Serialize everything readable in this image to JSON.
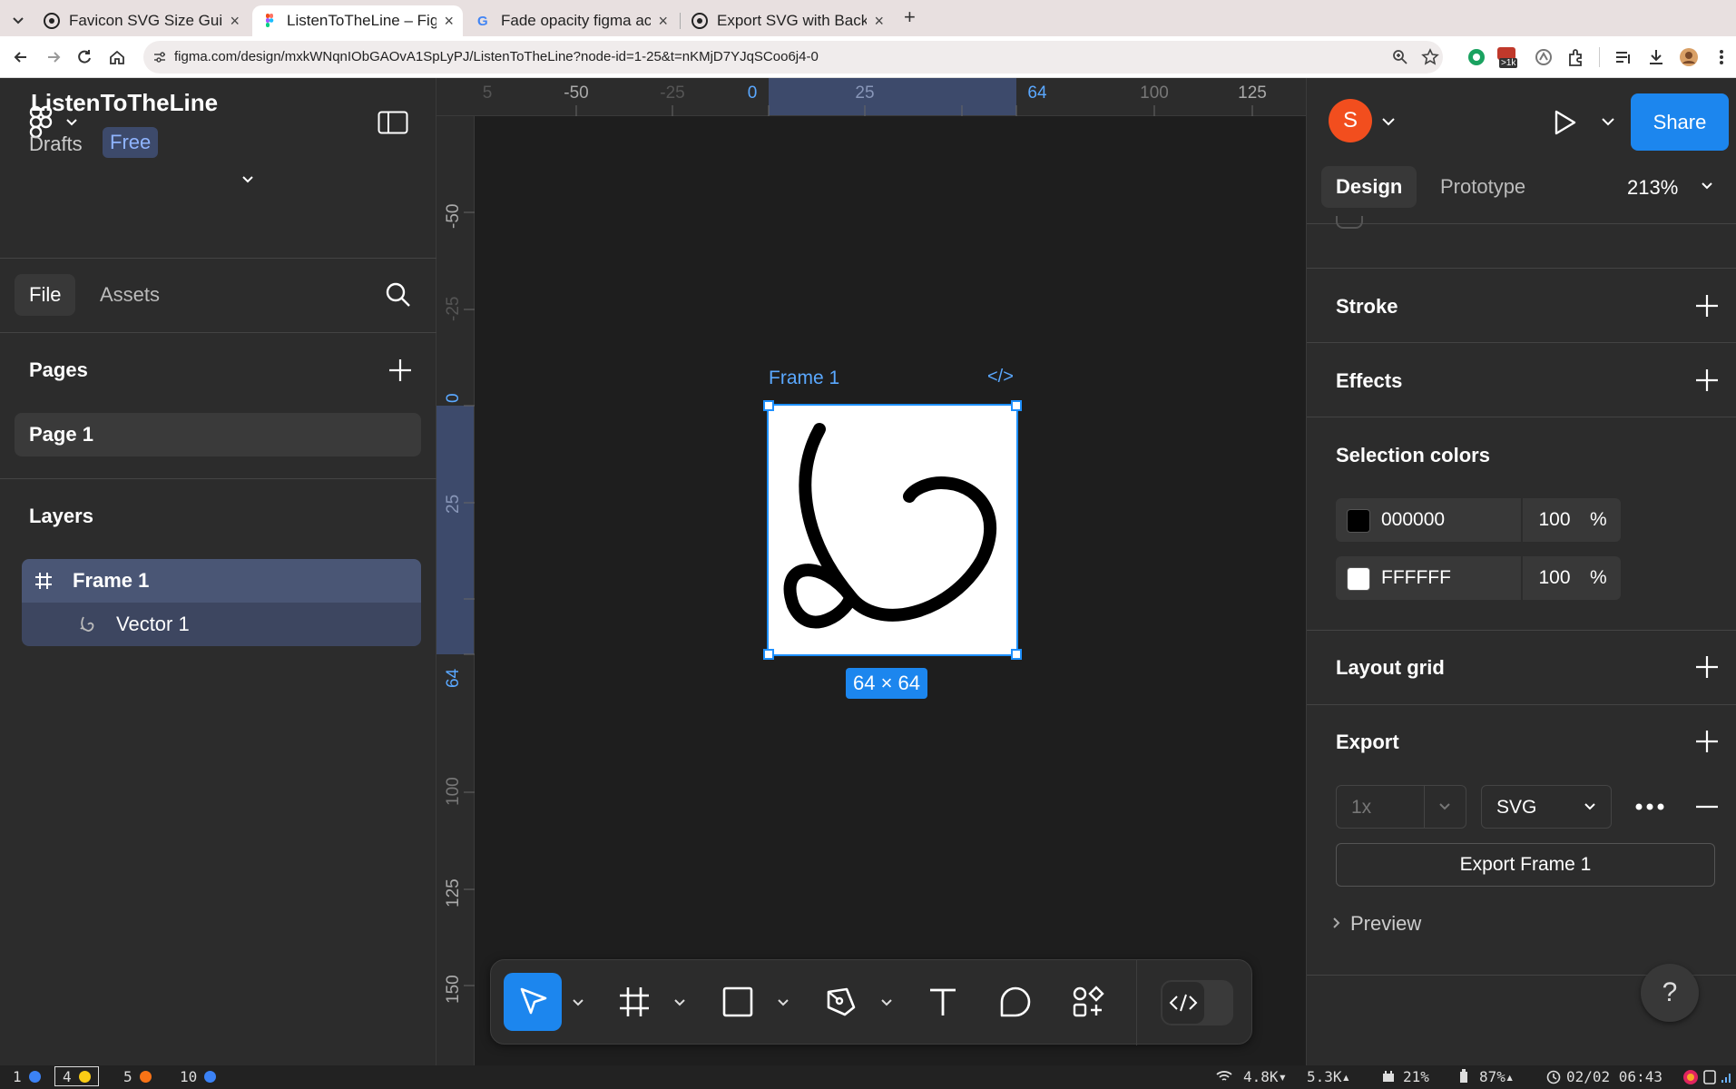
{
  "browser": {
    "tabs": [
      {
        "title": "Favicon SVG Size Guid"
      },
      {
        "title": "ListenToTheLine – Figm"
      },
      {
        "title": "Fade opacity figma ac"
      },
      {
        "title": "Export SVG with Back"
      }
    ],
    "new_tab": "+",
    "url": "figma.com/design/mxkWNqnIObGAOvA1SpLyPJ/ListenToTheLine?node-id=1-25&t=nKMjD7YJqSCoo6j4-0",
    "ext_badge": ">1k"
  },
  "left_panel": {
    "file_name": "ListenToTheLine",
    "drafts": "Drafts",
    "plan_badge": "Free",
    "tabs": {
      "file": "File",
      "assets": "Assets"
    },
    "pages_heading": "Pages",
    "pages": [
      "Page 1"
    ],
    "layers_heading": "Layers",
    "layers": [
      {
        "name": "Frame 1"
      },
      {
        "name": "Vector 1"
      }
    ]
  },
  "ruler_top": {
    "labels": [
      "-50",
      "-25",
      "0",
      "25",
      "64",
      "100",
      "125"
    ]
  },
  "ruler_left": {
    "labels": [
      "-50",
      "-25",
      "0",
      "25",
      "64",
      "100",
      "125",
      "150"
    ]
  },
  "canvas": {
    "frame_label": "Frame 1",
    "code_tag": "</>",
    "size_badge": "64 × 64"
  },
  "right_panel": {
    "avatar_initial": "S",
    "share_label": "Share",
    "tabs": {
      "design": "Design",
      "prototype": "Prototype"
    },
    "zoom": "213%",
    "sections": {
      "stroke": "Stroke",
      "effects": "Effects",
      "selection_colors": "Selection colors",
      "layout_grid": "Layout grid",
      "export": "Export"
    },
    "selection_colors": [
      {
        "hex": "000000",
        "swatch": "#000000",
        "opacity": "100",
        "unit": "%"
      },
      {
        "hex": "FFFFFF",
        "swatch": "#FFFFFF",
        "opacity": "100",
        "unit": "%"
      }
    ],
    "export": {
      "scale": "1x",
      "format": "SVG",
      "button_label": "Export Frame 1",
      "preview_label": "Preview"
    },
    "help": "?"
  },
  "statusbar": {
    "workspaces": [
      {
        "num": "1",
        "color": "#3b82f6"
      },
      {
        "num": "4",
        "color": "#facc15"
      },
      {
        "num": "5",
        "color": "#f97316"
      },
      {
        "num": "10",
        "color": "#3b82f6"
      }
    ],
    "net_down": "4.8K▾",
    "net_up": "5.3K▴",
    "cpu": "21%",
    "battery": "87%▴",
    "datetime": "02/02 06:43"
  },
  "colors": {
    "accent": "#1c86ee",
    "panel_bg": "#2c2c2c",
    "canvas_bg": "#1e1e1e",
    "avatar": "#f24e1e"
  }
}
